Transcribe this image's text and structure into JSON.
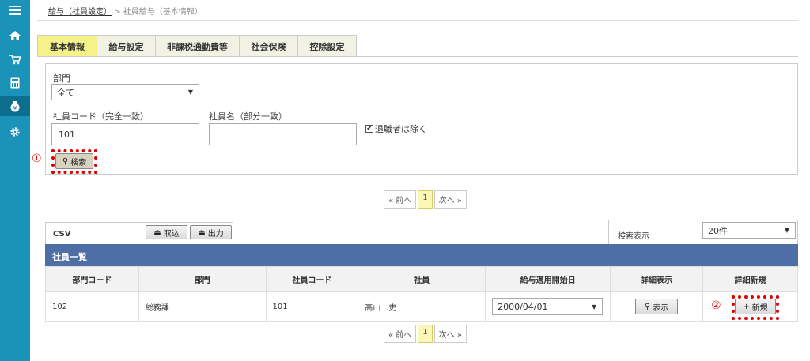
{
  "sidebar": {
    "icons": [
      "menu-icon",
      "home-icon",
      "cart-icon",
      "calculator-icon",
      "money-bag-icon",
      "gear-icon"
    ]
  },
  "breadcrumb": {
    "parent": "給与（社員設定）",
    "separator": ">",
    "current": "社員給与（基本情報）"
  },
  "tabs": [
    "基本情報",
    "給与設定",
    "非課税通勤費等",
    "社会保険",
    "控除設定"
  ],
  "filters": {
    "dept_label": "部門",
    "dept_value": "全て",
    "code_label": "社員コード（完全一致）",
    "code_value": "101",
    "name_label": "社員名（部分一致）",
    "name_value": "",
    "exclude_label": "退職者は除く",
    "exclude_checked": true,
    "search_label": "検索"
  },
  "annotations": {
    "one": "①",
    "two": "②"
  },
  "pager": {
    "prev": "« 前へ",
    "page": "1",
    "next": "次へ »"
  },
  "csv": {
    "label": "CSV",
    "import": "取込",
    "export": "出力"
  },
  "display": {
    "label": "検索表示",
    "value": "20件"
  },
  "list": {
    "title": "社員一覧",
    "headers": [
      "部門コード",
      "部門",
      "社員コード",
      "社員",
      "給与適用開始日",
      "詳細表示",
      "詳細新規"
    ],
    "row": {
      "dept_code": "102",
      "dept": "総務課",
      "emp_code": "101",
      "emp": "高山　史",
      "date": "2000/04/01",
      "show": "表示",
      "new": "新規"
    }
  },
  "colors": {
    "sidebar": "#1b93b8",
    "header_bar": "#4d6fa6",
    "active_tab": "#f6f28a",
    "highlight": "#e00000"
  }
}
